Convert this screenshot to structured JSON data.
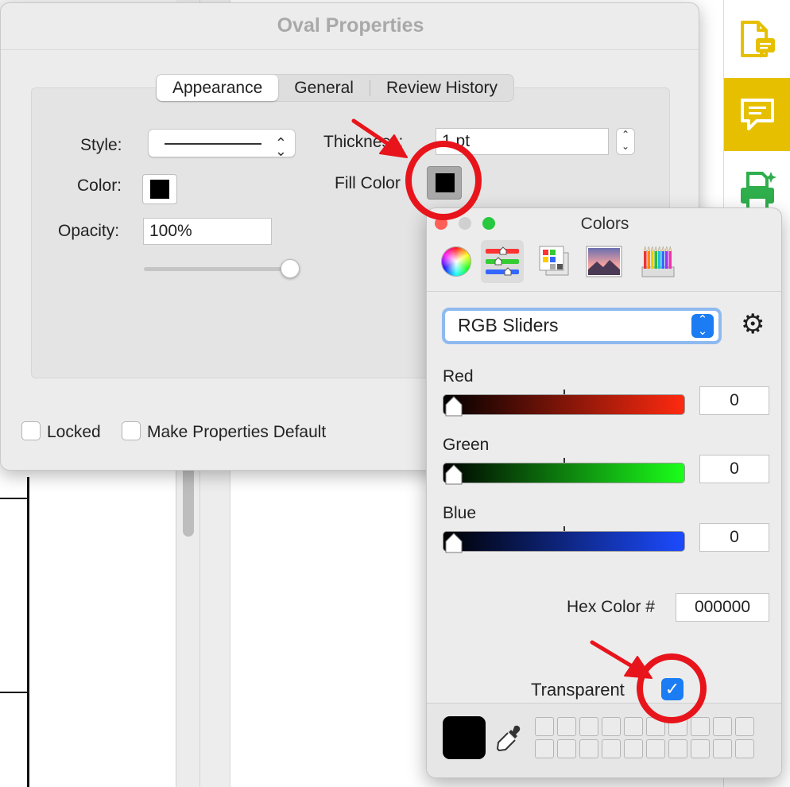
{
  "dialog": {
    "title": "Oval Properties",
    "tabs": [
      {
        "label": "Appearance",
        "selected": true
      },
      {
        "label": "General",
        "selected": false
      },
      {
        "label": "Review History",
        "selected": false
      }
    ],
    "style_label": "Style:",
    "color_label": "Color:",
    "opacity_label": "Opacity:",
    "opacity_value": "100%",
    "opacity_fraction": 1.0,
    "thickness_label": "Thickness:",
    "thickness_value": "1 pt",
    "fill_color_label": "Fill Color",
    "locked_label": "Locked",
    "make_default_label": "Make Properties Default",
    "stepper_up": "⌃",
    "stepper_down": "⌄"
  },
  "colors_panel": {
    "title": "Colors",
    "mode_selector_value": "RGB Sliders",
    "channels": [
      {
        "label": "Red",
        "value": "0"
      },
      {
        "label": "Green",
        "value": "0"
      },
      {
        "label": "Blue",
        "value": "0"
      }
    ],
    "hex_label": "Hex Color #",
    "hex_value": "000000",
    "transparent_label": "Transparent",
    "transparent_checked": true,
    "current_color": "#000000",
    "mode_icons": [
      "color-wheel-icon",
      "color-sliders-icon",
      "color-palettes-icon",
      "image-palettes-icon",
      "pencils-icon"
    ]
  },
  "toolbar": {
    "icons": [
      "document-comment-icon",
      "comment-icon",
      "printer-icon"
    ],
    "accent_color": "#e6c000"
  },
  "colors": {
    "annotation_red": "#e8141b",
    "accent_blue": "#1b7cf3",
    "traffic_red": "#ff5f57",
    "traffic_gray": "#d0d0d0",
    "traffic_green": "#28c840"
  }
}
